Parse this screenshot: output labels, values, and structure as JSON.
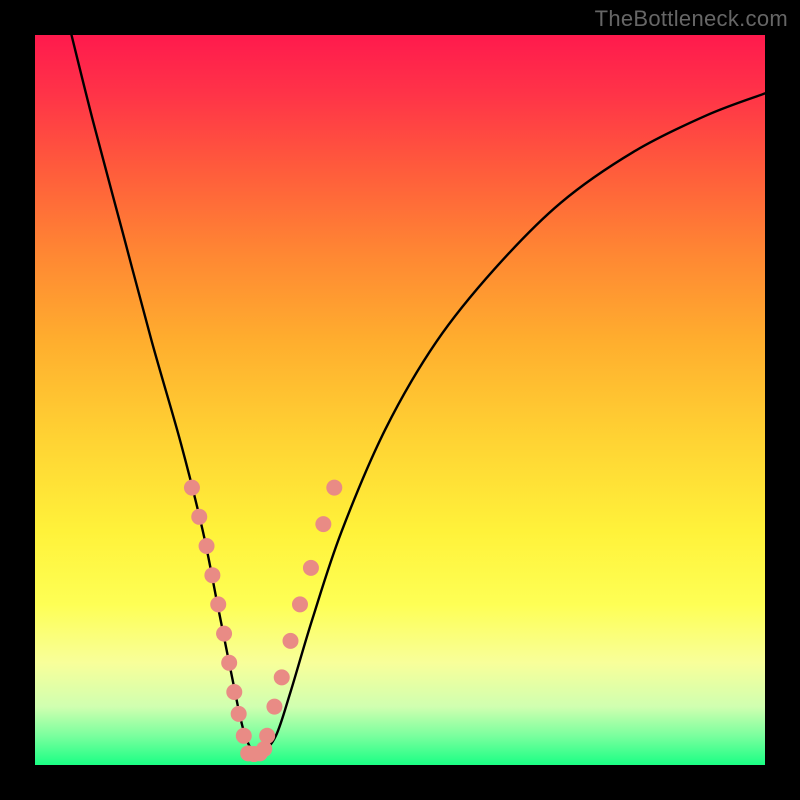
{
  "watermark": "TheBottleneck.com",
  "chart_data": {
    "type": "line",
    "title": "",
    "xlabel": "",
    "ylabel": "",
    "xlim": [
      0,
      100
    ],
    "ylim": [
      0,
      100
    ],
    "curve": {
      "name": "bottleneck-curve",
      "x": [
        5,
        8,
        12,
        16,
        20,
        23,
        25,
        27,
        28.5,
        30,
        31,
        33,
        35,
        38,
        42,
        48,
        55,
        63,
        72,
        82,
        92,
        100
      ],
      "y": [
        100,
        88,
        73,
        58,
        44,
        32,
        22,
        12,
        5,
        1.5,
        1.5,
        4,
        10,
        20,
        32,
        46,
        58,
        68,
        77,
        84,
        89,
        92
      ]
    },
    "markers_left": {
      "name": "left-branch-dots",
      "color": "#e98b85",
      "x": [
        21.5,
        22.5,
        23.5,
        24.3,
        25.1,
        25.9,
        26.6,
        27.3,
        27.9,
        28.6
      ],
      "y": [
        38,
        34,
        30,
        26,
        22,
        18,
        14,
        10,
        7,
        4
      ]
    },
    "markers_right": {
      "name": "right-branch-dots",
      "color": "#e98b85",
      "x": [
        31.8,
        32.8,
        33.8,
        35,
        36.3,
        37.8,
        39.5,
        41
      ],
      "y": [
        4,
        8,
        12,
        17,
        22,
        27,
        33,
        38
      ]
    },
    "markers_bottom": {
      "name": "trough-dots",
      "color": "#e98b85",
      "x": [
        29.2,
        30.0,
        30.8,
        31.4
      ],
      "y": [
        1.6,
        1.5,
        1.6,
        2.2
      ]
    }
  }
}
